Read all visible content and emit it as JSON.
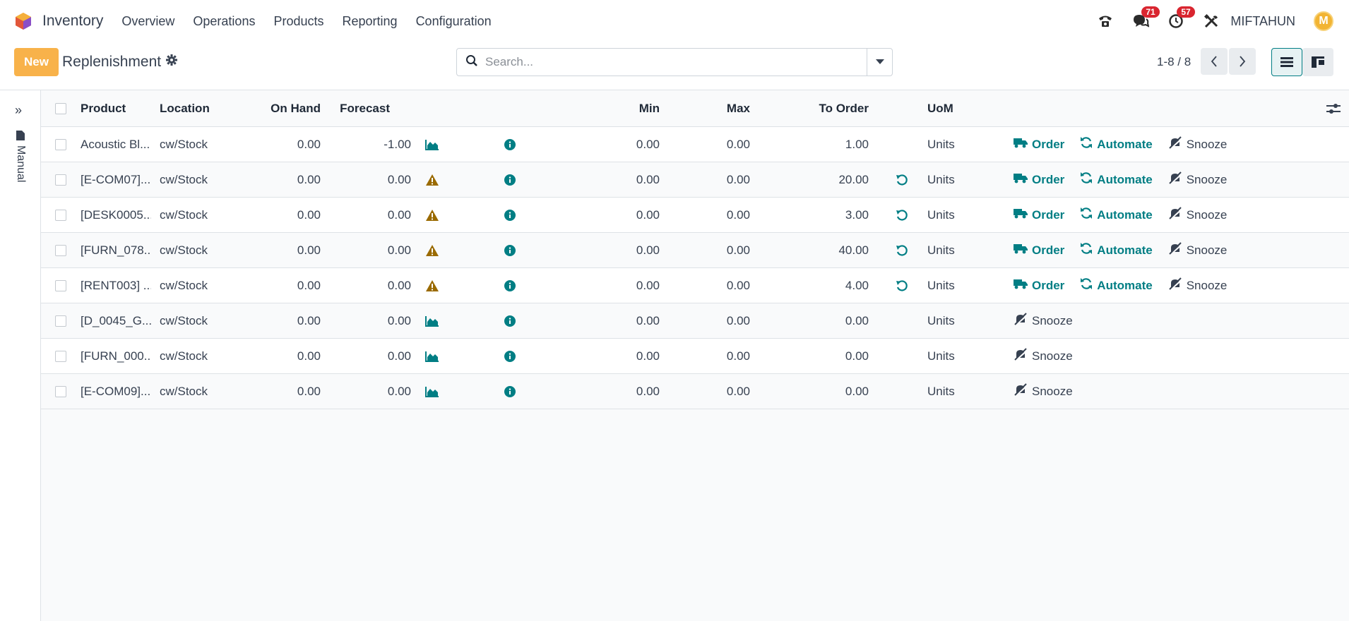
{
  "navbar": {
    "app_name": "Inventory",
    "menu": [
      "Overview",
      "Operations",
      "Products",
      "Reporting",
      "Configuration"
    ],
    "messages_count": "71",
    "activities_count": "57",
    "user_name": "MIFTAHUN",
    "avatar_letter": "M"
  },
  "control": {
    "new_label": "New",
    "title": "Replenishment",
    "search_placeholder": "Search...",
    "pager": "1-8 / 8"
  },
  "sidepanel": {
    "label": "Manual"
  },
  "table": {
    "headers": {
      "product": "Product",
      "location": "Location",
      "on_hand": "On Hand",
      "forecast": "Forecast",
      "min": "Min",
      "max": "Max",
      "to_order": "To Order",
      "uom": "UoM"
    },
    "action_labels": {
      "order": "Order",
      "automate": "Automate",
      "snooze": "Snooze"
    },
    "rows": [
      {
        "product": "Acoustic Bl...",
        "location": "cw/Stock",
        "on_hand": "0.00",
        "forecast": "-1.00",
        "forecast_icon": "chart-area-icon",
        "min": "0.00",
        "max": "0.00",
        "to_order": "1.00",
        "reset": false,
        "uom": "Units",
        "full_actions": true
      },
      {
        "product": "[E-COM07]...",
        "location": "cw/Stock",
        "on_hand": "0.00",
        "forecast": "0.00",
        "forecast_icon": "warning-icon",
        "min": "0.00",
        "max": "0.00",
        "to_order": "20.00",
        "reset": true,
        "uom": "Units",
        "full_actions": true
      },
      {
        "product": "[DESK0005...",
        "location": "cw/Stock",
        "on_hand": "0.00",
        "forecast": "0.00",
        "forecast_icon": "warning-icon",
        "min": "0.00",
        "max": "0.00",
        "to_order": "3.00",
        "reset": true,
        "uom": "Units",
        "full_actions": true
      },
      {
        "product": "[FURN_078...",
        "location": "cw/Stock",
        "on_hand": "0.00",
        "forecast": "0.00",
        "forecast_icon": "warning-icon",
        "min": "0.00",
        "max": "0.00",
        "to_order": "40.00",
        "reset": true,
        "uom": "Units",
        "full_actions": true
      },
      {
        "product": "[RENT003] ...",
        "location": "cw/Stock",
        "on_hand": "0.00",
        "forecast": "0.00",
        "forecast_icon": "warning-icon",
        "min": "0.00",
        "max": "0.00",
        "to_order": "4.00",
        "reset": true,
        "uom": "Units",
        "full_actions": true
      },
      {
        "product": "[D_0045_G...",
        "location": "cw/Stock",
        "on_hand": "0.00",
        "forecast": "0.00",
        "forecast_icon": "chart-area-icon",
        "min": "0.00",
        "max": "0.00",
        "to_order": "0.00",
        "reset": false,
        "uom": "Units",
        "full_actions": false
      },
      {
        "product": "[FURN_000...",
        "location": "cw/Stock",
        "on_hand": "0.00",
        "forecast": "0.00",
        "forecast_icon": "chart-area-icon",
        "min": "0.00",
        "max": "0.00",
        "to_order": "0.00",
        "reset": false,
        "uom": "Units",
        "full_actions": false
      },
      {
        "product": "[E-COM09]...",
        "location": "cw/Stock",
        "on_hand": "0.00",
        "forecast": "0.00",
        "forecast_icon": "chart-area-icon",
        "min": "0.00",
        "max": "0.00",
        "to_order": "0.00",
        "reset": false,
        "uom": "Units",
        "full_actions": false
      }
    ]
  },
  "colors": {
    "primary": "#017e84",
    "new_button": "#f8b24a",
    "warning": "#9a6a00",
    "badge": "#d9252f"
  }
}
